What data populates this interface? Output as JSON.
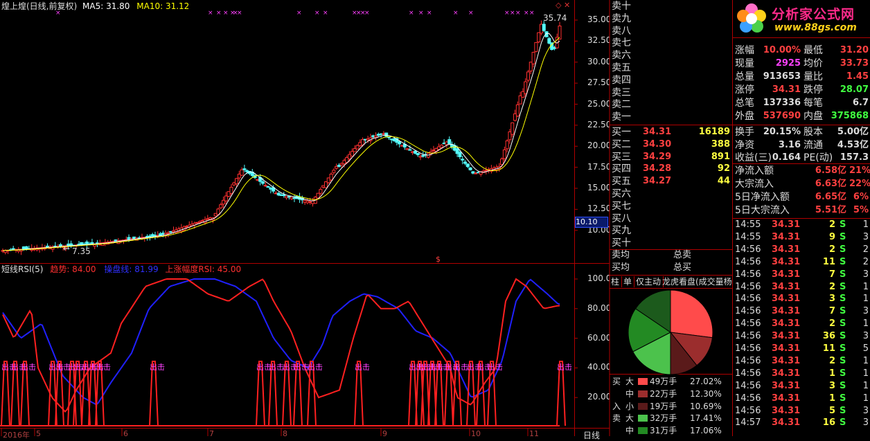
{
  "header": {
    "title": "煌上煌(日线,前复权)",
    "ma5_label": "MA5: 31.80",
    "ma10_label": "MA10: 31.12"
  },
  "price_axis": {
    "labels": [
      "35.00",
      "32.50",
      "30.00",
      "27.50",
      "25.00",
      "22.50",
      "20.00",
      "17.50",
      "15.00",
      "12.50",
      "10.00"
    ],
    "current": "10.10"
  },
  "annotations": {
    "high": "35.74",
    "low": "7.35",
    "marker": "$"
  },
  "indicator": {
    "name": "短线RSI(5)",
    "trend_label": "趋势: 84.00",
    "control_label": "操盘线: 81.99",
    "rise_label": "上涨幅度RSI: 45.00",
    "axis": [
      "100.0",
      "80.00",
      "60.00",
      "40.00",
      "20.00"
    ],
    "signal_text": "出击"
  },
  "date_axis": {
    "labels": [
      "2016年",
      "5",
      "6",
      "7",
      "8",
      "9",
      "10",
      "11"
    ],
    "period": "日线"
  },
  "order_book": {
    "sell_labels": [
      "卖十",
      "卖九",
      "卖八",
      "卖七",
      "卖六",
      "卖五",
      "卖四",
      "卖三",
      "卖二",
      "卖一"
    ],
    "buy": [
      {
        "label": "买一",
        "price": "34.31",
        "vol": "16189"
      },
      {
        "label": "买二",
        "price": "34.30",
        "vol": "388"
      },
      {
        "label": "买三",
        "price": "34.29",
        "vol": "891"
      },
      {
        "label": "买四",
        "price": "34.28",
        "vol": "92"
      },
      {
        "label": "买五",
        "price": "34.27",
        "vol": "44"
      },
      {
        "label": "买六",
        "price": "",
        "vol": ""
      },
      {
        "label": "买七",
        "price": "",
        "vol": ""
      },
      {
        "label": "买八",
        "price": "",
        "vol": ""
      },
      {
        "label": "买九",
        "price": "",
        "vol": ""
      },
      {
        "label": "买十",
        "price": "",
        "vol": ""
      }
    ],
    "sell_avg": "卖均",
    "sell_total": "总卖",
    "buy_avg": "买均",
    "buy_total": "总买"
  },
  "logo": {
    "title": "分析家公式网",
    "url": "www.88gs.com"
  },
  "quote": [
    {
      "l": "涨幅",
      "v": "10.00%",
      "l2": "最低",
      "v2": "31.20"
    },
    {
      "l": "现量",
      "v": "2925",
      "l2": "均价",
      "v2": "33.73"
    },
    {
      "l": "总量",
      "v": "913653",
      "l2": "量比",
      "v2": "1.45"
    },
    {
      "l": "涨停",
      "v": "34.31",
      "l2": "跌停",
      "v2": "28.07"
    },
    {
      "l": "总笔",
      "v": "137336",
      "l2": "每笔",
      "v2": "6.7"
    },
    {
      "l": "外盘",
      "v": "537690",
      "l2": "内盘",
      "v2": "375868"
    },
    {
      "l": "换手",
      "v": "20.15%",
      "l2": "股本",
      "v2": "5.00亿"
    },
    {
      "l": "净资",
      "v": "3.16",
      "l2": "流通",
      "v2": "4.53亿"
    },
    {
      "l": "收益(三)",
      "v": "0.164",
      "l2": "PE(动)",
      "v2": "157.3"
    }
  ],
  "flows": [
    {
      "l": "净流入额",
      "v": "6.58亿",
      "p": "21%"
    },
    {
      "l": "大宗流入",
      "v": "6.63亿",
      "p": "22%"
    },
    {
      "l": "5日净流入额",
      "v": "6.65亿",
      "p": "6%"
    },
    {
      "l": "5日大宗流入",
      "v": "5.51亿",
      "p": "5%"
    }
  ],
  "tabs": [
    "柱",
    "单",
    "仅主动",
    "龙虎看盘(成交量杨"
  ],
  "money": [
    {
      "side": "买",
      "size": "大",
      "amt": "49万手",
      "pct": "27.02%",
      "color": "#ff4b4b"
    },
    {
      "side": "",
      "size": "中",
      "amt": "22万手",
      "pct": "12.30%",
      "color": "#9b2d2d"
    },
    {
      "side": "入",
      "size": "小",
      "amt": "19万手",
      "pct": "10.69%",
      "color": "#5a1a1a"
    },
    {
      "side": "卖",
      "size": "大",
      "amt": "32万手",
      "pct": "17.41%",
      "color": "#4cc24c"
    },
    {
      "side": "",
      "size": "中",
      "amt": "31万手",
      "pct": "17.06%",
      "color": "#238a23"
    }
  ],
  "ticks": [
    {
      "t": "14:55",
      "p": "34.31",
      "v": "2",
      "s": "S",
      "n": "1"
    },
    {
      "t": "14:55",
      "p": "34.31",
      "v": "9",
      "s": "S",
      "n": "3"
    },
    {
      "t": "14:56",
      "p": "34.31",
      "v": "2",
      "s": "S",
      "n": "2"
    },
    {
      "t": "14:56",
      "p": "34.31",
      "v": "11",
      "s": "S",
      "n": "2"
    },
    {
      "t": "14:56",
      "p": "34.31",
      "v": "7",
      "s": "S",
      "n": "3"
    },
    {
      "t": "14:56",
      "p": "34.31",
      "v": "2",
      "s": "S",
      "n": "1"
    },
    {
      "t": "14:56",
      "p": "34.31",
      "v": "3",
      "s": "S",
      "n": "1"
    },
    {
      "t": "14:56",
      "p": "34.31",
      "v": "7",
      "s": "S",
      "n": "3"
    },
    {
      "t": "14:56",
      "p": "34.31",
      "v": "2",
      "s": "S",
      "n": "1"
    },
    {
      "t": "14:56",
      "p": "34.31",
      "v": "36",
      "s": "S",
      "n": "3"
    },
    {
      "t": "14:56",
      "p": "34.31",
      "v": "11",
      "s": "S",
      "n": "5"
    },
    {
      "t": "14:56",
      "p": "34.31",
      "v": "2",
      "s": "S",
      "n": "1"
    },
    {
      "t": "14:56",
      "p": "34.31",
      "v": "1",
      "s": "S",
      "n": "1"
    },
    {
      "t": "14:56",
      "p": "34.31",
      "v": "3",
      "s": "S",
      "n": "1"
    },
    {
      "t": "14:56",
      "p": "34.31",
      "v": "1",
      "s": "S",
      "n": "1"
    },
    {
      "t": "14:56",
      "p": "34.31",
      "v": "5",
      "s": "S",
      "n": "3"
    },
    {
      "t": "14:57",
      "p": "34.31",
      "v": "16",
      "s": "S",
      "n": "3"
    }
  ]
}
